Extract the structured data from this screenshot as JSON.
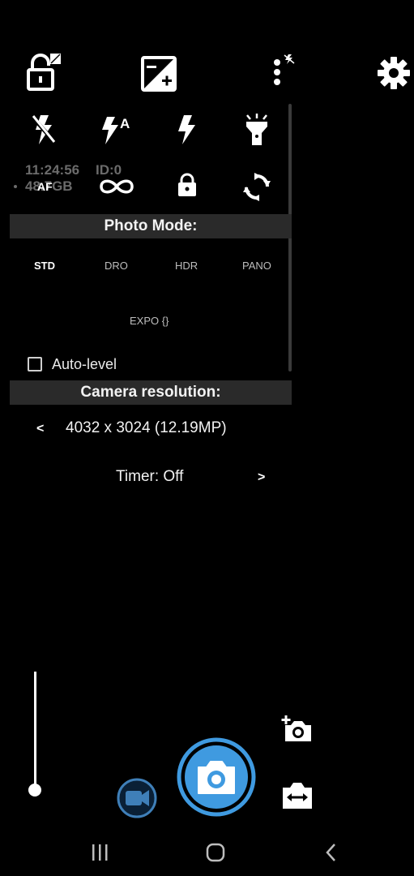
{
  "top_bar": {
    "icons": [
      "lock-exposure-icon",
      "exposure-compensation-icon",
      "popup-more-icon",
      "settings-gear-icon"
    ]
  },
  "flash_row": {
    "icons": [
      "flash-off-icon",
      "flash-auto-icon",
      "flash-on-icon",
      "torch-icon"
    ]
  },
  "focus_row": {
    "af_label": "AF",
    "icons": [
      "focus-infinity-icon",
      "lock-icon",
      "switch-camera-icon"
    ]
  },
  "overlay": {
    "time": "11:24:56",
    "id": "ID:0",
    "storage": "48.7GB"
  },
  "photo_mode": {
    "title": "Photo Mode:",
    "modes": [
      "STD",
      "DRO",
      "HDR",
      "PANO"
    ],
    "expo": "EXPO {}",
    "active": "STD"
  },
  "auto_level": {
    "label": "Auto-level",
    "checked": false
  },
  "camera_resolution": {
    "title": "Camera resolution:",
    "prev": "<",
    "value": "4032 x 3024 (12.19MP)"
  },
  "timer": {
    "label": "Timer: Off",
    "next": ">"
  },
  "zoom": {
    "level": 0.0
  },
  "bottom_controls": {
    "icons": [
      "video-mode-icon",
      "shutter-camera-icon",
      "add-camera-icon",
      "switch-lens-icon"
    ]
  },
  "nav_bar": {
    "icons": [
      "recent-apps-icon",
      "home-icon",
      "back-icon"
    ]
  },
  "colors": {
    "accent": "#3f9ae0",
    "background": "#000000",
    "section_bar": "#2a2a2a"
  }
}
